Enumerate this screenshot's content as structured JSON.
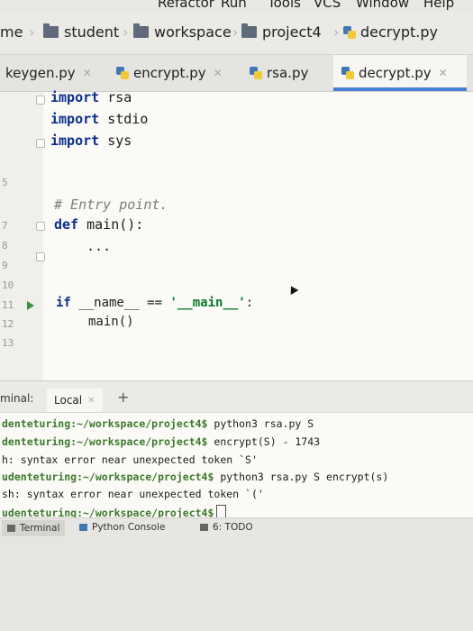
{
  "menubar": {
    "items": [
      "Refactor",
      "Run",
      "Tools",
      "VCS",
      "Window",
      "Help"
    ]
  },
  "breadcrumb": {
    "items": [
      "me",
      "student",
      "workspace",
      "project4",
      "decrypt.py"
    ]
  },
  "tabs": [
    {
      "label": "keygen.py",
      "active": false
    },
    {
      "label": "encrypt.py",
      "active": false
    },
    {
      "label": "rsa.py",
      "active": false
    },
    {
      "label": "decrypt.py",
      "active": true
    }
  ],
  "editor": {
    "line_numbers": [
      "5",
      "7",
      "8",
      "9",
      "10",
      "11",
      "12",
      "13"
    ],
    "lines": {
      "l1_kw": "import",
      "l1_mod": " rsa",
      "l2_kw": "import",
      "l2_mod": " stdio",
      "l3_kw": "import",
      "l3_mod": " sys",
      "l4_comment": "# Entry point.",
      "l5_kw": "def",
      "l5_rest": " main():",
      "l6": "...",
      "l7_kw": "if",
      "l7_name": " __name__ ",
      "l7_op": "== ",
      "l7_str": "'__main__'",
      "l7_colon": ":",
      "l8": "main()"
    }
  },
  "terminal": {
    "header_label": "minal:",
    "tab_label": "Local",
    "plus": "+",
    "lines": [
      {
        "prompt": "denteturing:~/workspace/project4$",
        "text": " python3 rsa.py S"
      },
      {
        "prompt": "denteturing:~/workspace/project4$",
        "text": " encrypt(S) - 1743"
      },
      {
        "prompt": "",
        "text": "h: syntax error near unexpected token `S'"
      },
      {
        "prompt": "udenteturing:~/workspace/project4$",
        "text": " python3 rsa.py S encrypt(s)"
      },
      {
        "prompt": "",
        "text": "sh: syntax error near unexpected token `('"
      },
      {
        "prompt": "udenteturing:~/workspace/project4$",
        "text": ""
      }
    ]
  },
  "toolbar": {
    "terminal": "Terminal",
    "python_console": "Python Console",
    "todo": "6: TODO"
  }
}
